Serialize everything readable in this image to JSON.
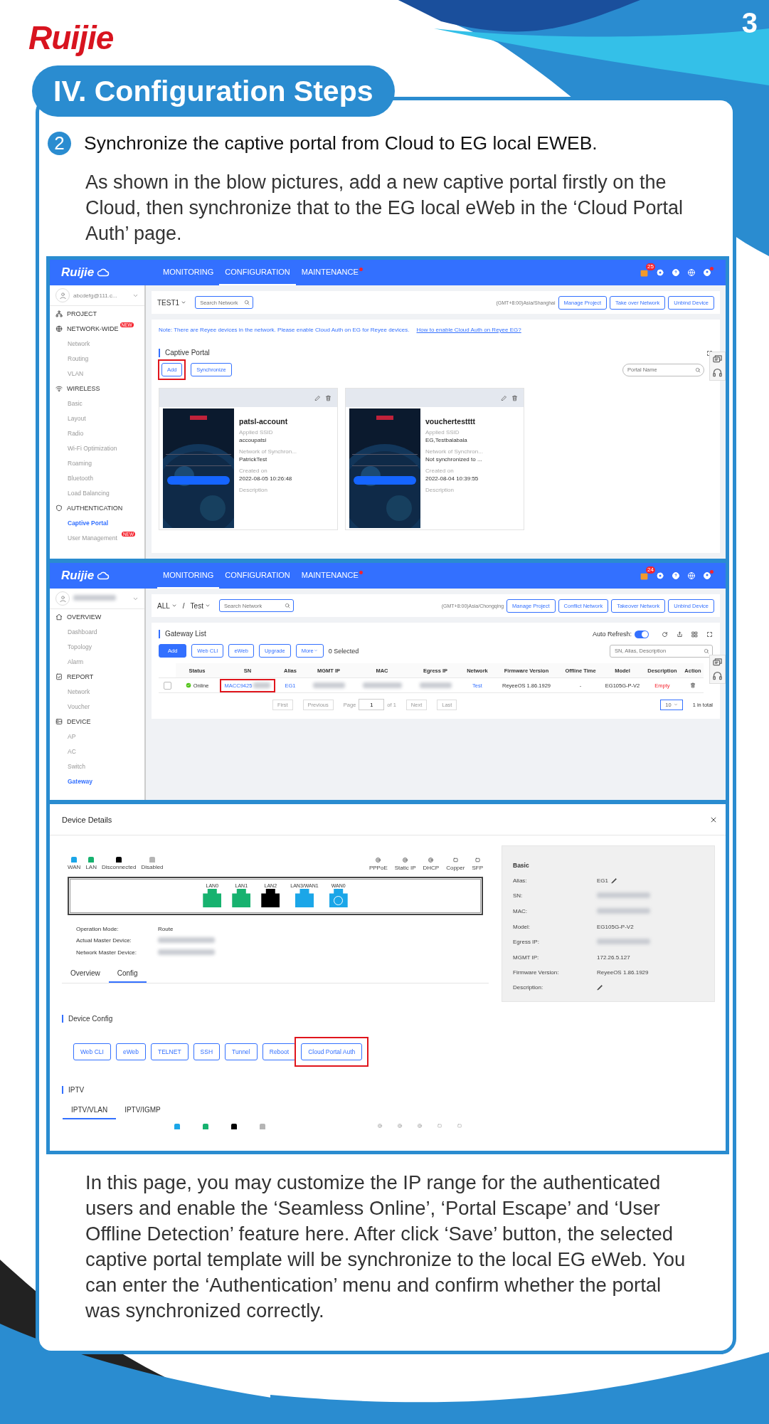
{
  "header": {
    "logo": "Ruijie",
    "page_number": "3"
  },
  "section": {
    "title": "IV. Configuration Steps"
  },
  "step": {
    "number": "2",
    "title": "Synchronize the captive portal from Cloud to EG local EWEB."
  },
  "intro": "As shown in the blow pictures, add a new captive portal firstly on the Cloud, then synchronize that to the EG local eWeb in the ‘Cloud Portal Auth’ page.",
  "screenshot_1": {
    "nav": {
      "logo": "Ruijie",
      "tabs": [
        {
          "label": "MONITORING",
          "selected": false,
          "alert": false
        },
        {
          "label": "CONFIGURATION",
          "selected": true,
          "alert": false
        },
        {
          "label": "MAINTENANCE",
          "selected": false,
          "alert": true
        }
      ],
      "notification_count": "25"
    },
    "account": "abcdefg@111.c...",
    "sidebar": [
      {
        "label": "PROJECT"
      },
      {
        "label": "NETWORK-WIDE",
        "badge": "NEW",
        "children": [
          {
            "label": "Network",
            "selected": false
          },
          {
            "label": "Routing",
            "selected": false
          },
          {
            "label": "VLAN",
            "selected": false
          }
        ]
      },
      {
        "label": "WIRELESS",
        "children": [
          {
            "label": "Basic",
            "selected": false
          },
          {
            "label": "Layout",
            "selected": false
          },
          {
            "label": "Radio",
            "selected": false
          },
          {
            "label": "Wi-Fi Optimization",
            "selected": false
          },
          {
            "label": "Roaming",
            "selected": false
          },
          {
            "label": "Bluetooth",
            "selected": false
          },
          {
            "label": "Load Balancing",
            "selected": false
          }
        ]
      },
      {
        "label": "AUTHENTICATION",
        "children": [
          {
            "label": "Captive Portal",
            "selected": true
          },
          {
            "label": "User Management",
            "selected": false,
            "badge": "NEW"
          }
        ]
      }
    ],
    "toolbar": {
      "project": "TEST1",
      "search_placeholder": "Search Network",
      "timezone": "(GMT+8:00)Asia/Shanghai",
      "buttons": [
        "Manage Project",
        "Take over Network",
        "Unbind Device"
      ]
    },
    "note": "Note: There are Reyee devices in the network. Please enable Cloud Auth on EG for Reyee devices.",
    "note_link": "How to enable Cloud Auth on Reyee EG?",
    "panel_title": "Captive Portal",
    "actions": [
      {
        "label": "Add",
        "highlighted": true
      },
      {
        "label": "Synchronize",
        "highlighted": false
      }
    ],
    "search_placeholder": "Portal Name",
    "portals": [
      {
        "name": "patsl-account",
        "fields": [
          {
            "label": "Applied SSID",
            "value": "accoupatsi"
          },
          {
            "label": "Network of Synchron...",
            "value": "PatrickTest"
          },
          {
            "label": "Created on",
            "value": "2022-08-05 10:26:48"
          },
          {
            "label": "Description"
          }
        ]
      },
      {
        "name": "vouchertestttt",
        "fields": [
          {
            "label": "Applied SSID",
            "value": "EG,Testbalabala"
          },
          {
            "label": "Network of Synchron...",
            "value": "Not synchronized to ..."
          },
          {
            "label": "Created on",
            "value": "2022-08-04 10:39:55"
          },
          {
            "label": "Description"
          }
        ]
      }
    ]
  },
  "screenshot_2": {
    "nav": {
      "logo": "Ruijie",
      "tabs": [
        {
          "label": "MONITORING",
          "selected": true,
          "alert": false
        },
        {
          "label": "CONFIGURATION",
          "selected": false,
          "alert": false
        },
        {
          "label": "MAINTENANCE",
          "selected": false,
          "alert": true
        }
      ],
      "notification_count": "24"
    },
    "account_blurred": true,
    "sidebar": [
      {
        "label": "OVERVIEW",
        "children": [
          {
            "label": "Dashboard",
            "selected": false
          },
          {
            "label": "Topology",
            "selected": false
          },
          {
            "label": "Alarm",
            "selected": false
          }
        ]
      },
      {
        "label": "REPORT",
        "children": [
          {
            "label": "Network",
            "selected": false
          },
          {
            "label": "Voucher",
            "selected": false
          }
        ]
      },
      {
        "label": "DEVICE",
        "children": [
          {
            "label": "AP",
            "selected": false
          },
          {
            "label": "AC",
            "selected": false
          },
          {
            "label": "Switch",
            "selected": false
          },
          {
            "label": "Gateway",
            "selected": true
          }
        ]
      }
    ],
    "toolbar": {
      "group": "ALL",
      "separator": "/",
      "project": "Test",
      "search_placeholder": "Search Network",
      "timezone": "(GMT+8:00)Asia/Chongqing",
      "buttons": [
        "Manage Project",
        "Conflict Network",
        "Takeover Network",
        "Unbind Device"
      ]
    },
    "panel_title": "Gateway List",
    "auto_refresh": {
      "label": "Auto Refresh:",
      "on": true
    },
    "actions": [
      {
        "label": "Add",
        "kind": "primary"
      },
      {
        "label": "Web CLI",
        "kind": "outline"
      },
      {
        "label": "eWeb",
        "kind": "outline"
      },
      {
        "label": "Upgrade",
        "kind": "outline"
      },
      {
        "label": "More",
        "kind": "dropdown"
      }
    ],
    "selected_count": "0 Selected",
    "search_placeholder": "SN, Alias, Description",
    "columns": [
      "Status",
      "SN",
      "Alias",
      "MGMT IP",
      "MAC",
      "Egress IP",
      "Network",
      "Firmware Version",
      "Offline Time",
      "Model",
      "Description",
      "Action"
    ],
    "rows": [
      {
        "checked": false,
        "status": "Online",
        "sn": "MACC9425",
        "sn_highlighted": true,
        "alias": "EG1",
        "network": "Test",
        "firmware": "ReyeeOS 1.86.1929",
        "offline_time": "-",
        "model": "EG105G-P-V2",
        "description": "Empty"
      }
    ],
    "pagination": {
      "first": "First",
      "previous": "Previous",
      "page_label": "Page",
      "page": "1",
      "of": "of 1",
      "next": "Next",
      "last": "Last",
      "page_size": "10",
      "total": "1 in total"
    }
  },
  "screenshot_3": {
    "title": "Device Details",
    "status_legend": [
      {
        "label": "WAN",
        "color": "#1ba6e8"
      },
      {
        "label": "LAN",
        "color": "#17b26f"
      },
      {
        "label": "Disconnected",
        "color": "#000000"
      },
      {
        "label": "Disabled",
        "color": "#b5b5b5"
      }
    ],
    "type_legend": [
      "PPPoE",
      "Static IP",
      "DHCP",
      "Copper",
      "SFP"
    ],
    "ports": [
      {
        "label": "LAN0",
        "color": "#17b26f",
        "dhcp": false
      },
      {
        "label": "LAN1",
        "color": "#17b26f",
        "dhcp": false
      },
      {
        "label": "LAN2",
        "color": "#000000",
        "dhcp": false
      },
      {
        "label": "LAN3/WAN1",
        "color": "#1ba6e8",
        "dhcp": false
      },
      {
        "label": "WAN0",
        "color": "#1ba6e8",
        "dhcp": true
      }
    ],
    "info": [
      {
        "label": "Operation Mode:",
        "value": "Route"
      },
      {
        "label": "Actual Master Device:",
        "blurred": true
      },
      {
        "label": "Network Master Device:",
        "blurred": true
      }
    ],
    "tabs": [
      {
        "label": "Overview",
        "selected": false
      },
      {
        "label": "Config",
        "selected": true
      }
    ],
    "basic": {
      "title": "Basic",
      "rows": [
        {
          "label": "Alias:",
          "value": "EG1",
          "editable": true
        },
        {
          "label": "SN:",
          "blurred": true
        },
        {
          "label": "MAC:",
          "blurred": true
        },
        {
          "label": "Model:",
          "value": "EG105G-P-V2"
        },
        {
          "label": "Egress IP:",
          "blurred": true
        },
        {
          "label": "MGMT IP:",
          "value": "172.26.5.127"
        },
        {
          "label": "Firmware Version:",
          "value": "ReyeeOS 1.86.1929"
        },
        {
          "label": "Description:",
          "editable": true
        }
      ]
    },
    "config_title": "Device Config",
    "config_buttons": [
      {
        "label": "Web CLI",
        "highlighted": false
      },
      {
        "label": "eWeb",
        "highlighted": false
      },
      {
        "label": "TELNET",
        "highlighted": false
      },
      {
        "label": "SSH",
        "highlighted": false
      },
      {
        "label": "Tunnel",
        "highlighted": false
      },
      {
        "label": "Reboot",
        "highlighted": false
      },
      {
        "label": "Cloud Portal Auth",
        "highlighted": true
      }
    ],
    "iptv_title": "IPTV",
    "iptv_tabs": [
      {
        "label": "IPTV/VLAN",
        "selected": true
      },
      {
        "label": "IPTV/IGMP",
        "selected": false
      }
    ]
  },
  "outro": "In this page, you may customize the IP range for the authenticated users and enable the ‘Seamless Online’, ‘Portal Escape’ and ‘User Offline Detection’ feature here. After click ‘Save’ button, the selected captive portal template will be synchronize to the local EG eWeb. You can enter the ‘Authentication’ menu and confirm whether the portal was synchronized correctly."
}
